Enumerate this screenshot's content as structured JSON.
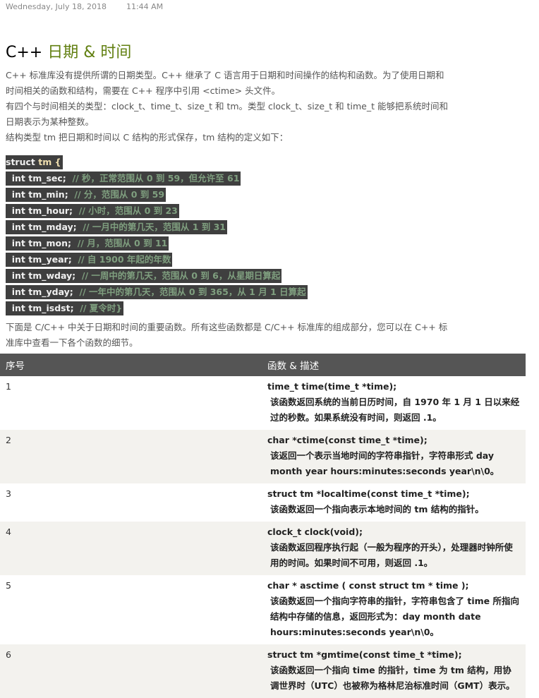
{
  "meta": {
    "date": "Wednesday, July 18, 2018",
    "time": "11:44 AM"
  },
  "title": {
    "prefix": "C++",
    "rest": "日期 & 时间"
  },
  "intro": [
    "C++ 标准库没有提供所谓的日期类型。C++ 继承了 C 语言用于日期和时间操作的结构和函数。为了使用日期和时间相关的函数和结构，需要在 C++ 程序中引用 <ctime> 头文件。",
    "有四个与时间相关的类型：clock_t、time_t、size_t 和 tm。类型 clock_t、size_t 和 time_t 能够把系统时间和日期表示为某种整数。",
    "结构类型 tm 把日期和时间以 C 结构的形式保存，tm 结构的定义如下："
  ],
  "code": {
    "head_kw": "struct",
    "head_ty": "tm",
    "head_brace": " {",
    "lines": [
      {
        "decl": "int tm_sec;",
        "comment": "// 秒，正常范围从 0 到 59，但允许至 61"
      },
      {
        "decl": "int tm_min;",
        "comment": "// 分，范围从 0 到 59"
      },
      {
        "decl": "int tm_hour;",
        "comment": "// 小时，范围从 0 到 23"
      },
      {
        "decl": "int tm_mday;",
        "comment": "// 一月中的第几天，范围从 1 到 31"
      },
      {
        "decl": "int tm_mon;",
        "comment": "// 月，范围从 0 到 11"
      },
      {
        "decl": "int tm_year;",
        "comment": "// 自 1900 年起的年数"
      },
      {
        "decl": "int tm_wday;",
        "comment": "// 一周中的第几天，范围从 0 到 6，从星期日算起"
      },
      {
        "decl": "int tm_yday;",
        "comment": "// 一年中的第几天，范围从 0 到 365，从 1 月 1 日算起"
      },
      {
        "decl": "int tm_isdst;",
        "comment": "// 夏令时}"
      }
    ]
  },
  "outro": "下面是 C/C++ 中关于日期和时间的重要函数。所有这些函数都是 C/C++ 标准库的组成部分，您可以在 C++ 标准库中查看一下各个函数的细节。",
  "table": {
    "headers": [
      "序号",
      "函数 & 描述"
    ],
    "rows": [
      {
        "n": "1",
        "fn": "time_t time(time_t *time);",
        "desc": "该函数返回系统的当前日历时间，自 1970 年 1 月 1 日以来经过的秒数。如果系统没有时间，则返回 .1。"
      },
      {
        "n": "2",
        "fn": "char *ctime(const time_t *time);",
        "desc": "该返回一个表示当地时间的字符串指针，字符串形式 day month year hours:minutes:seconds year\\n\\0。"
      },
      {
        "n": "3",
        "fn": "struct tm *localtime(const time_t *time);",
        "desc": "该函数返回一个指向表示本地时间的 tm 结构的指针。"
      },
      {
        "n": "4",
        "fn": "clock_t clock(void);",
        "desc": "该函数返回程序执行起（一般为程序的开头），处理器时钟所使用的时间。如果时间不可用，则返回 .1。"
      },
      {
        "n": "5",
        "fn": "char * asctime ( const struct tm * time );",
        "desc": "该函数返回一个指向字符串的指针，字符串包含了 time 所指向结构中存储的信息，返回形式为：day month date hours:minutes:seconds year\\n\\0。"
      },
      {
        "n": "6",
        "fn": "struct tm *gmtime(const time_t *time);",
        "desc": "该函数返回一个指向 time 的指针，time 为 tm 结构，用协调世界时（UTC）也被称为格林尼治标准时间（GMT）表示。"
      }
    ]
  }
}
